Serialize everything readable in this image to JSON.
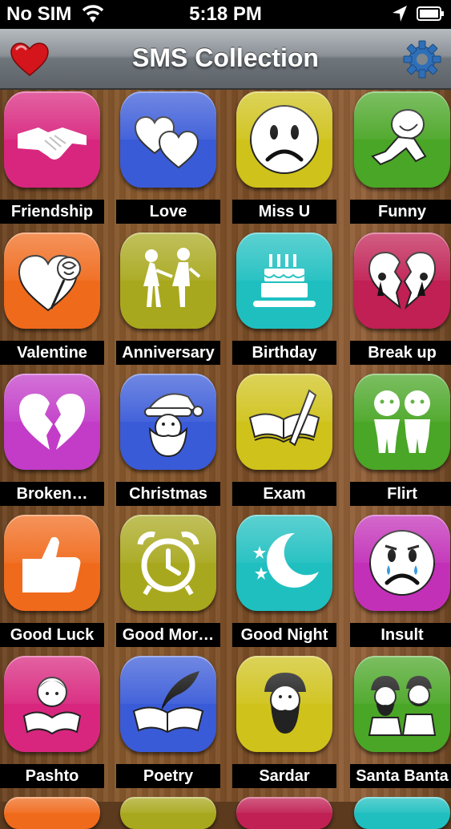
{
  "status_bar": {
    "carrier": "No SIM",
    "time": "5:18 PM"
  },
  "nav": {
    "title": "SMS Collection"
  },
  "colors": {
    "pink": "#d8267e",
    "blue": "#3a5bd8",
    "yellow": "#cfc21a",
    "green": "#4aa626",
    "orange": "#f06a1c",
    "olive": "#a8a81e",
    "teal": "#1fbfc0",
    "magenta": "#c230b8"
  },
  "categories": [
    {
      "label": "Friendship",
      "icon": "handshake-icon"
    },
    {
      "label": "Love",
      "icon": "two-hearts-icon"
    },
    {
      "label": "Miss U",
      "icon": "sad-face-icon"
    },
    {
      "label": "Funny",
      "icon": "laughing-man-icon"
    },
    {
      "label": "Valentine",
      "icon": "heart-rose-icon"
    },
    {
      "label": "Anniversary",
      "icon": "couple-icon"
    },
    {
      "label": "Birthday",
      "icon": "cake-icon"
    },
    {
      "label": "Break up",
      "icon": "broken-heart-couple-icon"
    },
    {
      "label": "Broken…",
      "icon": "broken-heart-icon"
    },
    {
      "label": "Christmas",
      "icon": "santa-icon"
    },
    {
      "label": "Exam",
      "icon": "book-pen-icon"
    },
    {
      "label": "Flirt",
      "icon": "kids-icon"
    },
    {
      "label": "Good Luck",
      "icon": "thumbs-up-icon"
    },
    {
      "label": "Good Mor…",
      "icon": "alarm-clock-icon"
    },
    {
      "label": "Good Night",
      "icon": "moon-stars-icon"
    },
    {
      "label": "Insult",
      "icon": "crying-face-icon"
    },
    {
      "label": "Pashto",
      "icon": "reading-boy-icon"
    },
    {
      "label": "Poetry",
      "icon": "quill-book-icon"
    },
    {
      "label": "Sardar",
      "icon": "sardar-icon"
    },
    {
      "label": "Santa Banta",
      "icon": "santa-banta-icon"
    }
  ]
}
